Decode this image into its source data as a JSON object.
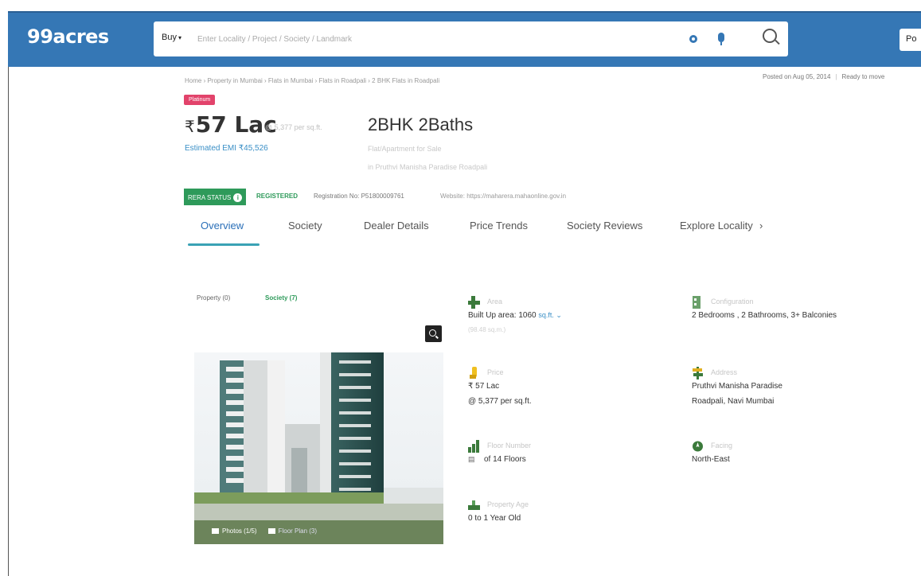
{
  "header": {
    "logo": "99acres",
    "buy_label": "Buy",
    "search_placeholder": "Enter Locality / Project / Society / Landmark",
    "post_label": "Po"
  },
  "meta": {
    "breadcrumb": "Home › Property in Mumbai › Flats in Mumbai › Flats in Roadpali › 2 BHK Flats in Roadpali",
    "posted": "Posted on Aug 05, 2014",
    "status": "Ready to move"
  },
  "listing": {
    "badge": "Platinum",
    "price": "57 Lac",
    "price_per": "@ 5,377 per sq.ft.",
    "emi": "Estimated EMI ₹45,526",
    "title": "2BHK 2Baths",
    "subtitle": "Flat/Apartment for Sale",
    "location": "in Pruthvi Manisha Paradise Roadpali"
  },
  "rera": {
    "label": "RERA STATUS",
    "status": "REGISTERED",
    "reg_no": "Registration No: P51800009761",
    "website": "Website: https://maharera.mahaonline.gov.in"
  },
  "tabs": [
    "Overview",
    "Society",
    "Dealer Details",
    "Price Trends",
    "Society Reviews",
    "Explore Locality"
  ],
  "media": {
    "tab_property": "Property (0)",
    "tab_society": "Society (7)",
    "photos": "Photos (1/5)",
    "floor_plan": "Floor Plan (3)"
  },
  "details": {
    "area": {
      "label": "Area",
      "value": "Built Up area: 1060",
      "unit": "sq.ft.",
      "extra": "(98.48 sq.m.)"
    },
    "configuration": {
      "label": "Configuration",
      "value": "2 Bedrooms , 2 Bathrooms, 3+ Balconies"
    },
    "price": {
      "label": "Price",
      "value": "₹ 57 Lac",
      "value2": "@ 5,377 per sq.ft."
    },
    "address": {
      "label": "Address",
      "value": "Pruthvi Manisha Paradise",
      "value2": "Roadpali, Navi Mumbai"
    },
    "floor": {
      "label": "Floor Number",
      "value": "of 14 Floors"
    },
    "facing": {
      "label": "Facing",
      "value": "North-East"
    },
    "age": {
      "label": "Property Age",
      "value": "0 to 1 Year Old"
    }
  },
  "colors": {
    "brand": "#3577b5",
    "rera_green": "#2e9a5a",
    "badge_pink": "#e2436b",
    "tab_accent": "#3aa2b5"
  }
}
